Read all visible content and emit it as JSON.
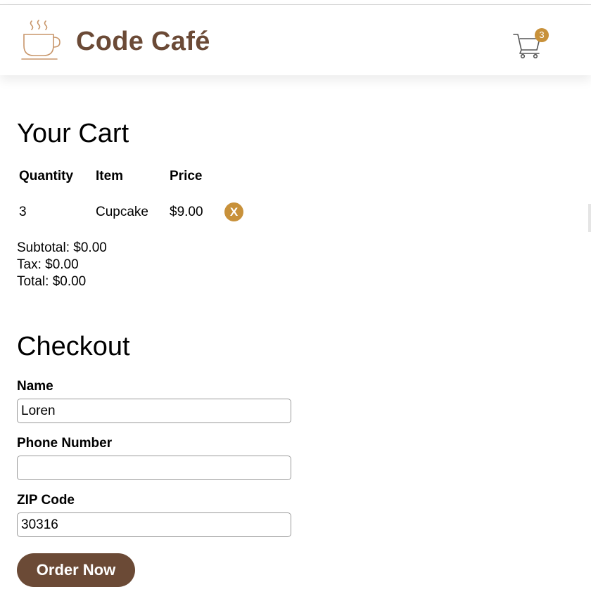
{
  "header": {
    "brand": "Code Café",
    "logo_icon": "coffee-cup-icon",
    "cart_icon": "shopping-cart-icon",
    "cart_count": "3",
    "brand_color": "#6b4a36",
    "accent_color": "#c8913a"
  },
  "cart": {
    "title": "Your Cart",
    "columns": [
      "Quantity",
      "Item",
      "Price"
    ],
    "items": [
      {
        "quantity": "3",
        "item": "Cupcake",
        "price": "$9.00",
        "remove_label": "X"
      }
    ],
    "subtotal": "Subtotal: $0.00",
    "tax": "Tax: $0.00",
    "total": "Total: $0.00"
  },
  "checkout": {
    "title": "Checkout",
    "name_label": "Name",
    "name_value": "Loren",
    "phone_label": "Phone Number",
    "phone_value": "",
    "zip_label": "ZIP Code",
    "zip_value": "30316",
    "submit_label": "Order Now"
  }
}
